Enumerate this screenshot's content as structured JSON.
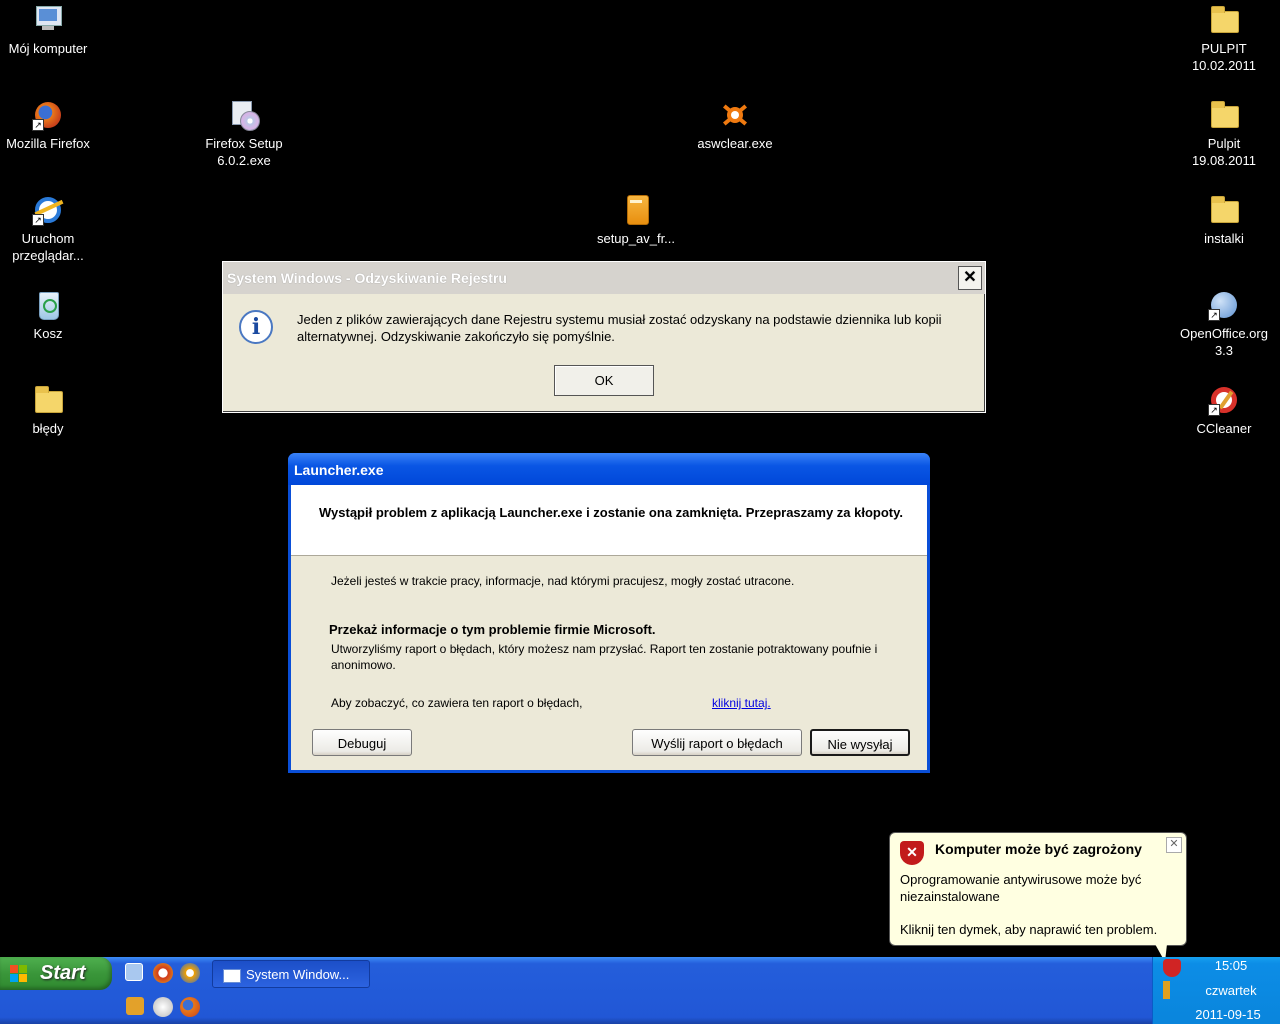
{
  "desktop": {
    "icons_left": [
      {
        "label": "Mój komputer",
        "icon": "my-computer-icon"
      },
      {
        "label": "Mozilla Firefox",
        "icon": "firefox-icon"
      },
      {
        "label": "Uruchom przeglądar...",
        "icon": "internet-explorer-icon"
      },
      {
        "label": "Kosz",
        "icon": "recycle-bin-icon"
      },
      {
        "label": "błędy",
        "icon": "folder-icon"
      }
    ],
    "icons_middle": [
      {
        "label": "Firefox Setup 6.0.2.exe",
        "icon": "installer-cd-icon"
      },
      {
        "label": "aswclear.exe",
        "icon": "avast-icon"
      },
      {
        "label": "setup_av_fr...",
        "icon": "setup-package-icon"
      }
    ],
    "icons_right": [
      {
        "label": "PULPIT 10.02.2011",
        "icon": "folder-icon"
      },
      {
        "label": "Pulpit 19.08.2011",
        "icon": "folder-icon"
      },
      {
        "label": "instalki",
        "icon": "folder-icon"
      },
      {
        "label": "OpenOffice.org 3.3",
        "icon": "openoffice-icon"
      },
      {
        "label": "CCleaner",
        "icon": "ccleaner-icon"
      }
    ]
  },
  "registry_dialog": {
    "title": "System Windows - Odzyskiwanie Rejestru",
    "message": "Jeden z plików zawierających dane Rejestru systemu musiał zostać odzyskany na podstawie dziennika lub kopii alternatywnej. Odzyskiwanie zakończyło się pomyślnie.",
    "ok_label": "OK"
  },
  "launcher_dialog": {
    "title": "Launcher.exe",
    "heading": "Wystąpił problem z aplikacją Launcher.exe i zostanie ona zamknięta. Przepraszamy za kłopoty.",
    "work_lost_text": "Jeżeli jesteś w trakcie pracy, informacje, nad którymi pracujesz, mogły zostać utracone.",
    "report_heading": "Przekaż informacje o tym problemie firmie Microsoft.",
    "report_text": "Utworzyliśmy raport o błędach, który możesz nam przysłać. Raport ten zostanie potraktowany poufnie i anonimowo.",
    "see_report_text": "Aby zobaczyć, co zawiera ten raport o błędach,",
    "click_here_link": "kliknij tutaj.",
    "debug_label": "Debuguj",
    "send_label": "Wyślij raport o błędach",
    "dont_send_label": "Nie wysyłaj"
  },
  "balloon": {
    "title": "Komputer może być zagrożony",
    "body": "Oprogramowanie antywirusowe może być niezainstalowane",
    "action": "Kliknij ten dymek, aby naprawić ten problem."
  },
  "taskbar": {
    "start_label": "Start",
    "window_button_label": "System Window...",
    "clock_time": "15:05",
    "clock_day": "czwartek",
    "clock_date": "2011-09-15"
  }
}
